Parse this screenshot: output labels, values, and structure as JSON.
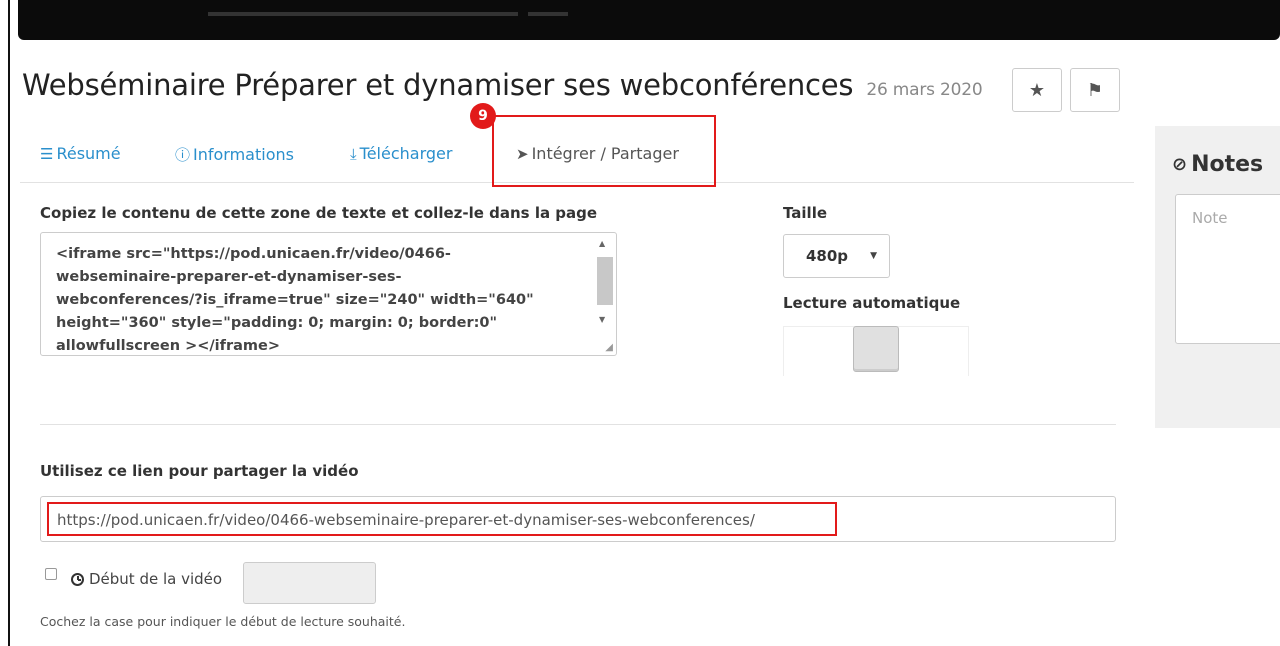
{
  "video": {
    "title": "Webséminaire Préparer et dynamiser ses webconférences",
    "date": "26 mars 2020"
  },
  "actions": {
    "star_icon": "★",
    "flag_icon": "⚑"
  },
  "annotation": {
    "step_number": "9",
    "highlight_color": "#e21a1a"
  },
  "tabs": [
    {
      "label": "Résumé",
      "icon": "list-icon"
    },
    {
      "label": "Informations",
      "icon": "info-icon"
    },
    {
      "label": "Télécharger",
      "icon": "download-icon"
    },
    {
      "label": "Intégrer / Partager",
      "icon": "send-icon",
      "active": true
    }
  ],
  "embed": {
    "label": "Copiez le contenu de cette zone de texte et collez-le dans la page",
    "code": "<iframe src=\"https://pod.unicaen.fr/video/0466-\nwebseminaire-preparer-et-dynamiser-ses-\nwebconferences/?is_iframe=true\" size=\"240\" width=\"640\"\nheight=\"360\" style=\"padding: 0; margin: 0; border:0\"\nallowfullscreen ></iframe>"
  },
  "size": {
    "label": "Taille",
    "selected": "480p"
  },
  "autoplay": {
    "label": "Lecture automatique"
  },
  "share": {
    "label": "Utilisez ce lien pour partager la vidéo",
    "url": "https://pod.unicaen.fr/video/0466-webseminaire-preparer-et-dynamiser-ses-webconferences/"
  },
  "start": {
    "label": "Début de la vidéo",
    "help": "Cochez la case pour indiquer le début de lecture souhaité."
  },
  "notes": {
    "title": "Notes",
    "placeholder": "Note"
  },
  "colors": {
    "link_blue": "#2a8fcc",
    "accent_red": "#e21a1a"
  }
}
